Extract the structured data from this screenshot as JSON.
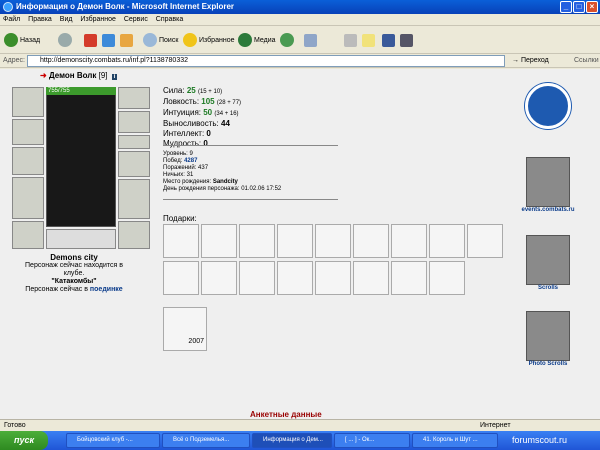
{
  "window": {
    "title": "Информация о Демон Волк - Microsoft Internet Explorer"
  },
  "menu": [
    "Файл",
    "Правка",
    "Вид",
    "Избранное",
    "Сервис",
    "Справка"
  ],
  "toolbar": {
    "back": "Назад",
    "search": "Поиск",
    "favorites": "Избранное",
    "media": "Медиа"
  },
  "address": {
    "label": "Адрес:",
    "url": "http://demonscity.combats.ru/inf.pl?1138780332",
    "go": "Переход",
    "links": "Ссылки"
  },
  "character": {
    "name": "Демон Волк",
    "level": "[9]",
    "info_icon": "i",
    "hp": "755/755",
    "location_title": "Demons city",
    "location_line1": "Персонаж сейчас находится в клубе.",
    "location_club": "\"Катакомбы\"",
    "location_line2a": "Персонаж сейчас в",
    "location_link": "поединке"
  },
  "stats": [
    {
      "label": "Сила:",
      "value": "25",
      "extra": "(15 + 10)"
    },
    {
      "label": "Ловкость:",
      "value": "105",
      "extra": "(28 + 77)"
    },
    {
      "label": "Интуиция:",
      "value": "50",
      "extra": "(34 + 16)"
    },
    {
      "label": "Выносливость:",
      "value": "44",
      "extra": ""
    },
    {
      "label": "Интеллект:",
      "value": "0",
      "extra": ""
    },
    {
      "label": "Мудрость:",
      "value": "0",
      "extra": ""
    }
  ],
  "info": {
    "level": "Уровень: 9",
    "wins_label": "Побед:",
    "wins": "4287",
    "losses": "Поражений: 437",
    "draws": "Ничьих: 31",
    "birthplace_label": "Место рождения:",
    "birthplace": "Sandcity",
    "birthday": "День рождения персонажа: 01.02.06 17:52"
  },
  "gifts": {
    "title": "Подарки:",
    "year": "2007"
  },
  "side_buttons": [
    {
      "label": "events.combats.ru"
    },
    {
      "label": "Scrolls"
    },
    {
      "label": "Photo Scrolls"
    }
  ],
  "bottom": {
    "title": "Анкетные данные"
  },
  "status": {
    "left": "Готово",
    "zone": "Интернет"
  },
  "taskbar": {
    "start": "пуск",
    "tasks": [
      "Бойцовский клуб -...",
      "Всё о Подземелья...",
      "Информация о Дем...",
      "[ ... ] - Ок...",
      "41. Король и Шут ..."
    ]
  },
  "watermark": "forumscout.ru"
}
